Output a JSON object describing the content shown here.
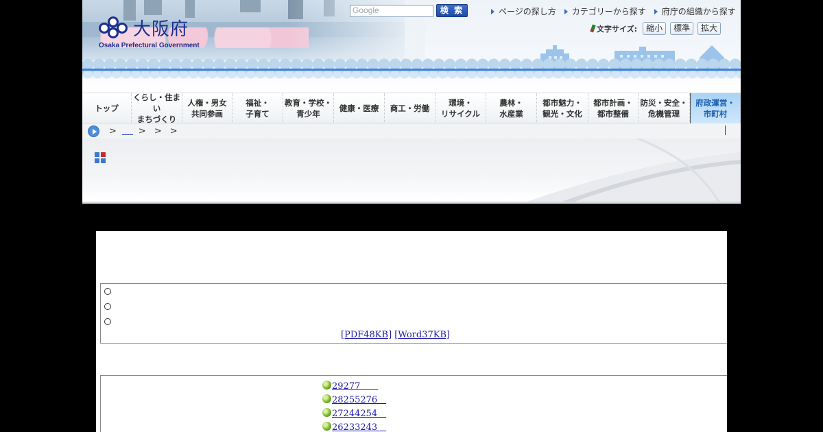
{
  "header": {
    "logo_text": "大阪府",
    "logo_subtitle": "Osaka Prefectural Government",
    "search": {
      "placeholder": "Google",
      "button_label": "検 索"
    },
    "util_links": [
      "ページの探し方",
      "カテゴリーから探す",
      "府庁の組織から探す"
    ],
    "font_size": {
      "label": "文字サイズ:",
      "buttons": [
        "縮小",
        "標準",
        "拡大"
      ]
    }
  },
  "global_nav": {
    "items": [
      "トップ",
      "くらし・住まい\nまちづくり",
      "人権・男女\n共同参画",
      "福祉・\n子育て",
      "教育・学校・\n青少年",
      "健康・医療",
      "商工・労働",
      "環境・\nリサイクル",
      "農林・\n水産業",
      "都市魅力・\n観光・文化",
      "都市計画・\n都市整備",
      "防災・安全・\n危機管理",
      "府政運営・\n市町村"
    ],
    "active_index": 12
  },
  "breadcrumb": {
    "separators": [
      ">",
      ">",
      ">",
      ">"
    ]
  },
  "colors": {
    "accent": "#1a2f8e",
    "link": "#1a1aa6",
    "nav_active": "#cfe7fb"
  },
  "content": {
    "radio_rows": [
      "",
      "",
      ""
    ],
    "doc_links": {
      "pdf": "[PDF48KB]",
      "word": "[Word37KB]"
    },
    "count_items": [
      "29277　　",
      "28255276　",
      "27244254　",
      "26233243　"
    ]
  }
}
